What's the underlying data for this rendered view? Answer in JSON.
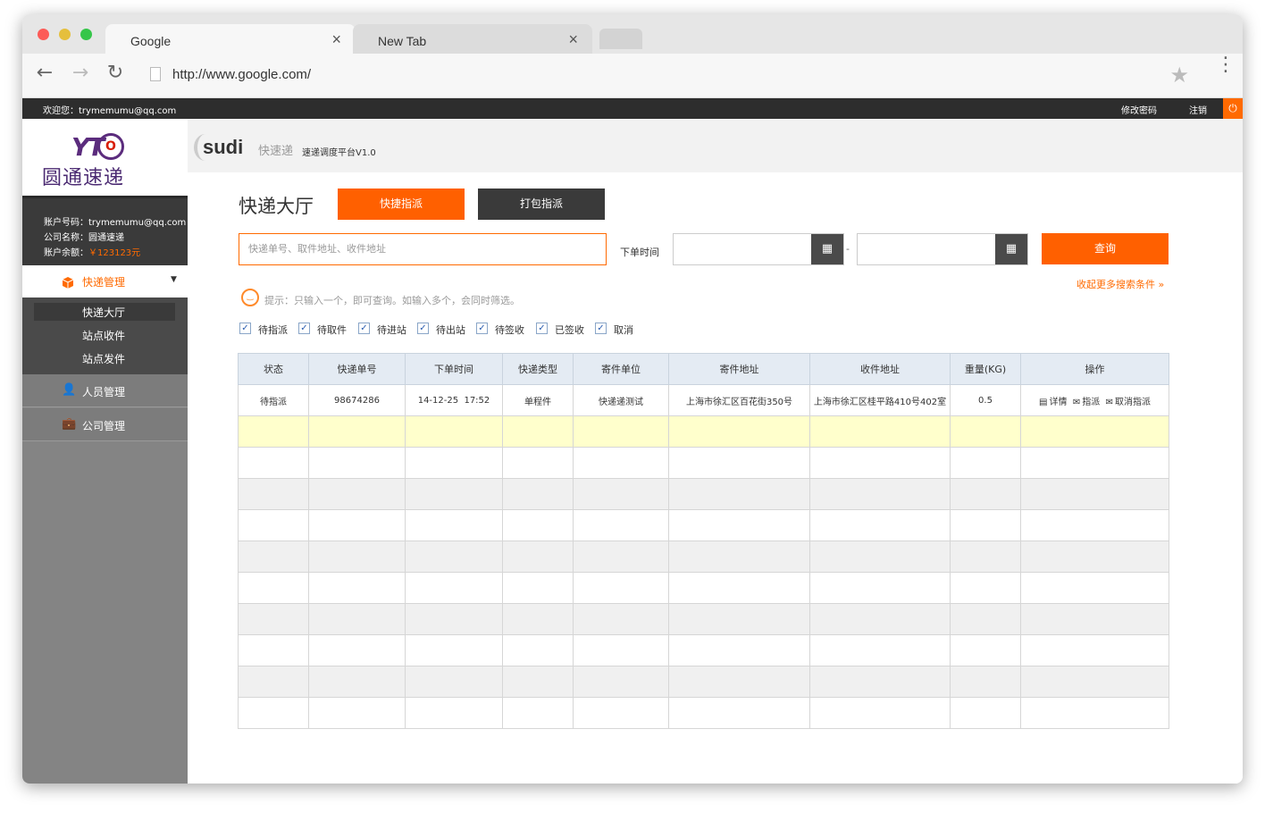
{
  "browser": {
    "tabs": [
      {
        "label": "Google",
        "close": "×"
      },
      {
        "label": "New Tab",
        "close": "×"
      }
    ],
    "url": "http://www.google.com/"
  },
  "topbar": {
    "welcome": "欢迎您：trymemumu@qq.com",
    "change_password": "修改密码",
    "logout": "注销"
  },
  "logo": {
    "mark": "YT",
    "mark2": "O",
    "name": "圆通速递"
  },
  "account": {
    "number": "账户号码：trymemumu@qq.com",
    "company": "公司名称：圆通速递",
    "balance_label": "账户余额：",
    "balance_value": "￥123123元"
  },
  "sidebar": {
    "main": "快递管理",
    "sub": [
      "快递大厅",
      "站点收件",
      "站点发件"
    ],
    "items": [
      "人员管理",
      "公司管理"
    ]
  },
  "brand": {
    "word": "sudi",
    "cn": "快速递",
    "version": "速递调度平台V1.0"
  },
  "page": {
    "title": "快递大厅",
    "quick_dispatch": "快捷指派",
    "pack_dispatch": "打包指派",
    "search_placeholder": "快递单号、取件地址、收件地址",
    "date_label": "下单时间",
    "date_sep": "-",
    "query": "查询",
    "hint": "提示：只输入一个，即可查询。如输入多个，会同时筛选。",
    "collapse": "收起更多搜索条件 »"
  },
  "filters": [
    "待指派",
    "待取件",
    "待进站",
    "待出站",
    "待签收",
    "已签收",
    "取消"
  ],
  "table": {
    "columns": [
      "状态",
      "快递单号",
      "下单时间",
      "快递类型",
      "寄件单位",
      "寄件地址",
      "收件地址",
      "重量(KG)",
      "操作"
    ],
    "rows": [
      {
        "status": "待指派",
        "number": "98674286",
        "time": "14-12-25  17:52",
        "type": "单程件",
        "unit": "快递递测试",
        "from": "上海市徐汇区百花街350号",
        "to": "上海市徐汇区桂平路410号402室",
        "weight": "0.5",
        "ops": [
          "详情",
          "指派",
          "取消指派"
        ]
      }
    ]
  }
}
